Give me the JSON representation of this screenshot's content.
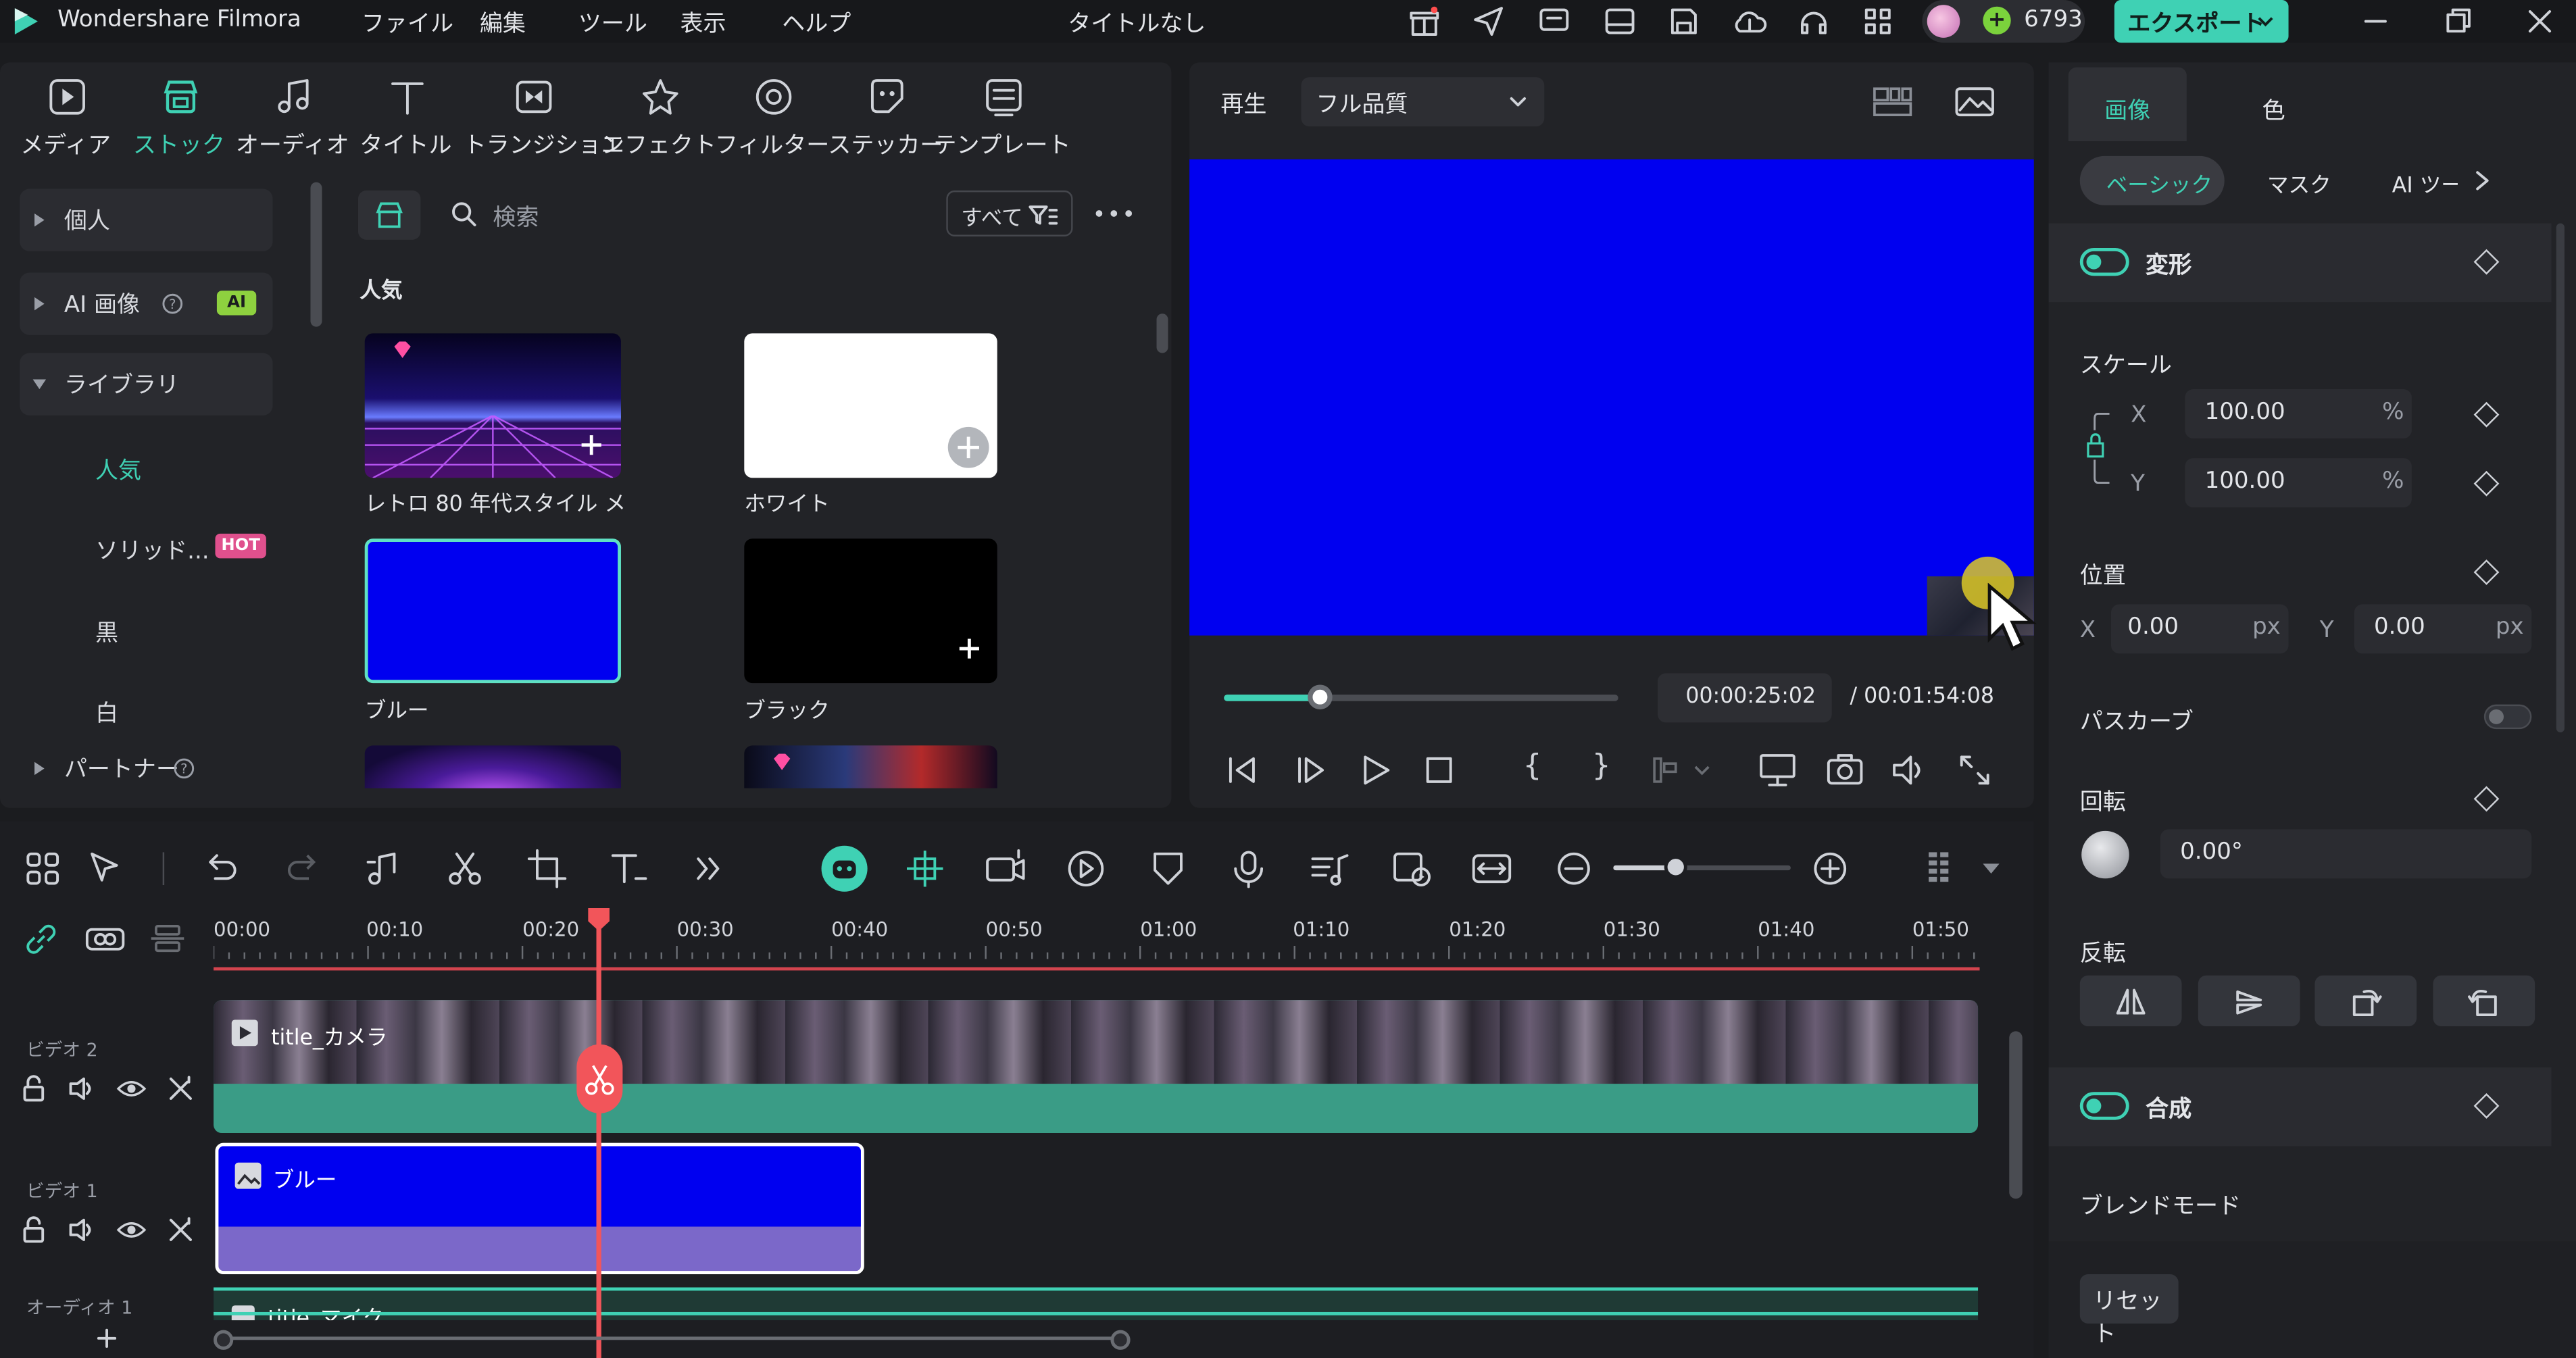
{
  "app": {
    "name": "Wondershare Filmora",
    "project_title": "タイトルなし",
    "credits": "6793",
    "export_label": "エクスポート"
  },
  "menu": [
    "ファイル",
    "編集",
    "ツール",
    "表示",
    "ヘルプ"
  ],
  "toolbar": [
    "メディア",
    "ストック",
    "オーディオ",
    "タイトル",
    "トランジション",
    "エフェクト",
    "フィルター",
    "ステッカー",
    "テンプレート"
  ],
  "sidebar": {
    "personal": "個人",
    "ai_image": "AI 画像",
    "ai_badge": "AI",
    "library": "ライブラリ",
    "popular": "人気",
    "solid": "ソリッド...",
    "hot_badge": "HOT",
    "black": "黒",
    "white": "白",
    "partner": "パートナー"
  },
  "stock": {
    "search_placeholder": "検索",
    "filter_label": "すべて",
    "section_title": "人気",
    "items": [
      "レトロ 80 年代スタイル メ...",
      "ホワイト",
      "ブルー",
      "ブラック"
    ]
  },
  "preview": {
    "play_label": "再生",
    "quality": "フル品質",
    "current_time": "00:00:25:02",
    "total_time": "/ 00:01:54:08",
    "progress": 0.24,
    "accent": "#3fd1b4",
    "canvas_color": "#0000f0"
  },
  "props": {
    "tab_image": "画像",
    "tab_color": "色",
    "subtab_basic": "ベーシック",
    "subtab_mask": "マスク",
    "subtab_ai": "AI ツー",
    "transform": "変形",
    "scale": "スケール",
    "scale_x": "100.00",
    "scale_y": "100.00",
    "percent": "%",
    "position": "位置",
    "pos_x": "0.00",
    "pos_y": "0.00",
    "px": "px",
    "x_label": "X",
    "y_label": "Y",
    "path_curve": "パスカーブ",
    "rotation": "回転",
    "rotation_value": "0.00°",
    "flip": "反転",
    "composite": "合成",
    "blend_mode": "ブレンドモード",
    "reset": "リセット"
  },
  "timeline": {
    "ruler": [
      "00:00",
      "00:10",
      "00:20",
      "00:30",
      "00:40",
      "00:50",
      "01:00",
      "01:10",
      "01:20",
      "01:30",
      "01:40",
      "01:50"
    ],
    "tracks": {
      "video2": "ビデオ 2",
      "video1": "ビデオ 1",
      "audio1": "オーディオ 1"
    },
    "clips": {
      "camera": "title_カメラ",
      "blue": "ブルー",
      "mic": "title_マイク"
    }
  }
}
